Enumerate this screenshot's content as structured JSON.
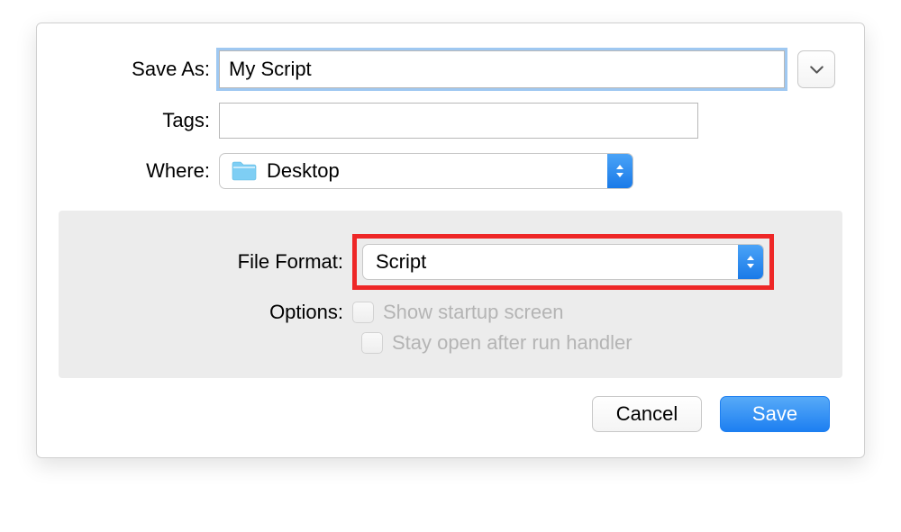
{
  "saveAs": {
    "label": "Save As:",
    "value": "My Script"
  },
  "tags": {
    "label": "Tags:",
    "value": ""
  },
  "where": {
    "label": "Where:",
    "selected": "Desktop"
  },
  "fileFormat": {
    "label": "File Format:",
    "selected": "Script"
  },
  "options": {
    "label": "Options:",
    "showStartup": "Show startup screen",
    "stayOpen": "Stay open after run handler"
  },
  "buttons": {
    "cancel": "Cancel",
    "save": "Save"
  }
}
